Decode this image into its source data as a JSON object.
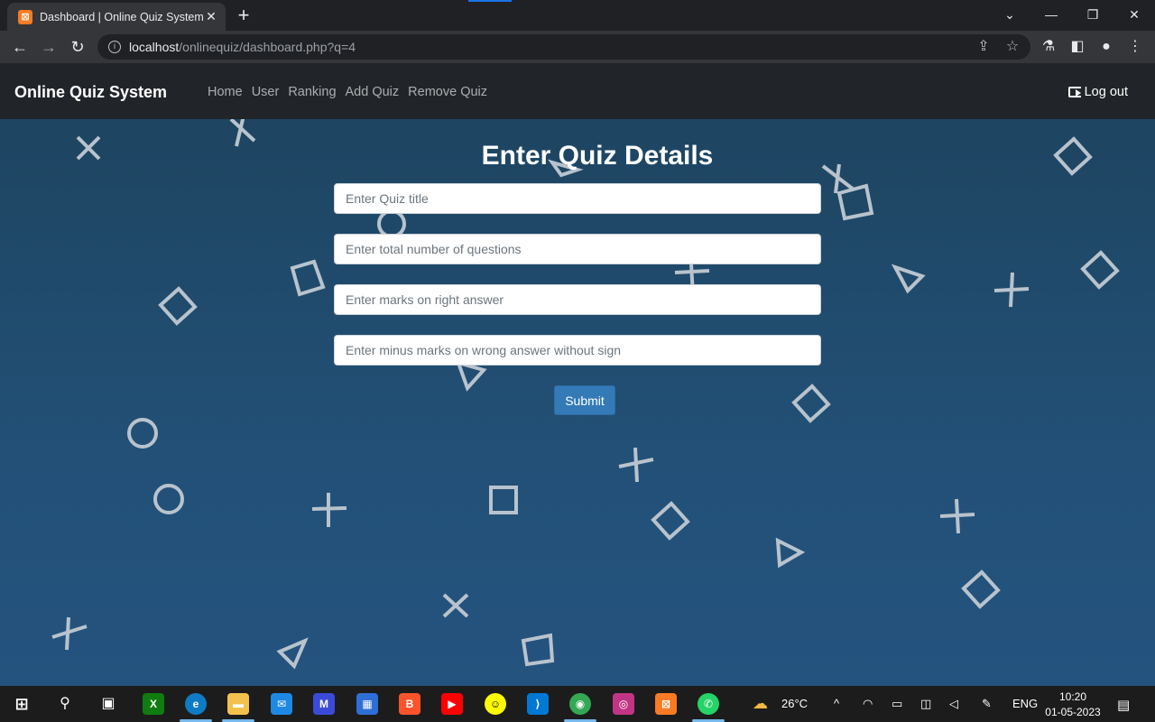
{
  "browser": {
    "tab_title": "Dashboard | Online Quiz System",
    "url_host": "localhost",
    "url_path": "/onlinequiz/dashboard.php?q=4"
  },
  "app": {
    "brand": "Online Quiz System",
    "nav": [
      "Home",
      "User",
      "Ranking",
      "Add Quiz",
      "Remove Quiz"
    ],
    "logout_label": "Log out"
  },
  "form": {
    "title": "Enter Quiz Details",
    "fields": [
      {
        "placeholder": "Enter Quiz title",
        "value": ""
      },
      {
        "placeholder": "Enter total number of questions",
        "value": ""
      },
      {
        "placeholder": "Enter marks on right answer",
        "value": ""
      },
      {
        "placeholder": "Enter minus marks on wrong answer without sign",
        "value": ""
      }
    ],
    "submit_label": "Submit"
  },
  "taskbar": {
    "weather_temp": "26°C",
    "language": "ENG",
    "time": "10:20",
    "date": "01-05-2023"
  },
  "colors": {
    "navbar": "#212529",
    "background_top": "#1e4561",
    "background_bottom": "#24537f",
    "submit": "#337ab7"
  }
}
